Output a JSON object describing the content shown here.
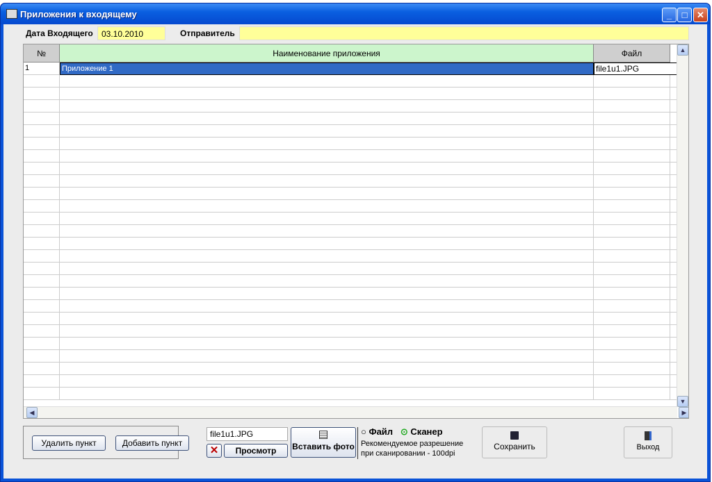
{
  "window": {
    "title": "Приложения к входящему"
  },
  "header": {
    "date_label": "Дата Входящего",
    "date_value": "03.10.2010",
    "sender_label": "Отправитель",
    "sender_value": ""
  },
  "table": {
    "columns": [
      "№",
      "Наименование приложения",
      "Файл"
    ],
    "rows": [
      {
        "num": "1",
        "name": "Приложение 1",
        "file": "file1u1.JPG"
      }
    ],
    "empty_rows": 26
  },
  "buttons": {
    "delete": "Удалить пункт",
    "add": "Добавить пункт",
    "view": "Просмотр",
    "insert_photo": "Вставить фото",
    "save": "Сохранить",
    "exit": "Выход"
  },
  "file_field": "file1u1.JPG",
  "source": {
    "file_label": "Файл",
    "scanner_label": "Сканер",
    "selected": "scanner",
    "hint1": "Рекомендуемое разрешение",
    "hint2": "при сканировании - 100dpi"
  }
}
